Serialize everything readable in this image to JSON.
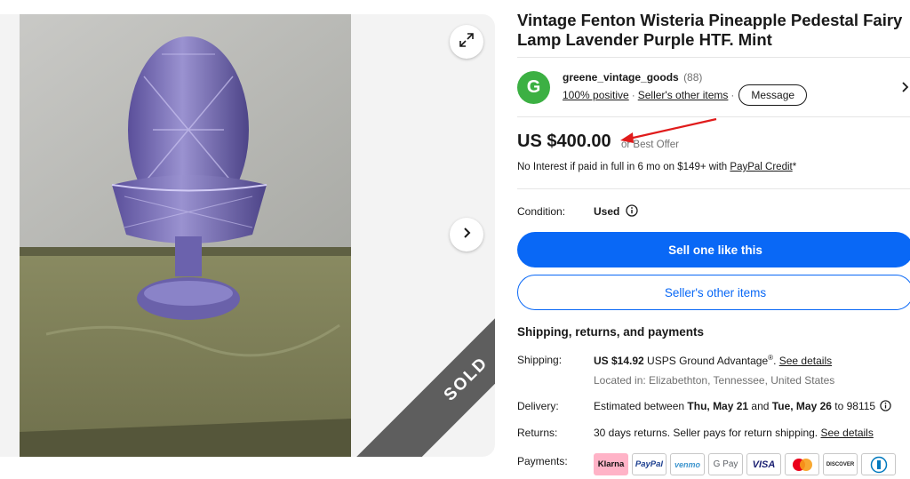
{
  "gallery": {
    "sold_label": "SOLD",
    "expand_icon": "expand-icon",
    "next_icon": "chevron-right-icon"
  },
  "listing": {
    "title": "Vintage Fenton Wisteria Pineapple Pedestal Fairy Lamp Lavender Purple HTF. Mint"
  },
  "seller": {
    "avatar_letter": "G",
    "name": "greene_vintage_goods",
    "feedback_count": "(88)",
    "positive": "100% positive",
    "other_items": "Seller's other items",
    "message_button": "Message",
    "avatar_color": "#3cb043"
  },
  "price": {
    "amount": "US $400.00",
    "best_offer": "or Best Offer",
    "credit_text": "No Interest if paid in full in 6 mo on $149+ with ",
    "credit_link": "PayPal Credit",
    "credit_suffix": "*"
  },
  "condition": {
    "label": "Condition:",
    "value": "Used"
  },
  "actions": {
    "sell_one": "Sell one like this",
    "sellers_other": "Seller's other items",
    "primary_color": "#0968f6"
  },
  "shipping": {
    "heading": "Shipping, returns, and payments",
    "shipping_label": "Shipping:",
    "shipping_price": "US $14.92",
    "shipping_method": " USPS Ground Advantage",
    "shipping_reg": "®",
    "shipping_sep": ". ",
    "see_details": "See details",
    "location": "Located in: Elizabethton, Tennessee, United States",
    "delivery_label": "Delivery:",
    "delivery_pre": "Estimated between ",
    "delivery_start": "Thu, May 21",
    "delivery_and": " and ",
    "delivery_end": "Tue, May 26",
    "delivery_to": " to 98115",
    "returns_label": "Returns:",
    "returns_text": "30 days returns. Seller pays for return shipping. ",
    "returns_link": "See details",
    "payments_label": "Payments:",
    "payment_methods": [
      "Klarna",
      "PayPal",
      "venmo",
      "G Pay",
      "VISA",
      "mastercard",
      "DISCOVER",
      "diners-club"
    ]
  }
}
